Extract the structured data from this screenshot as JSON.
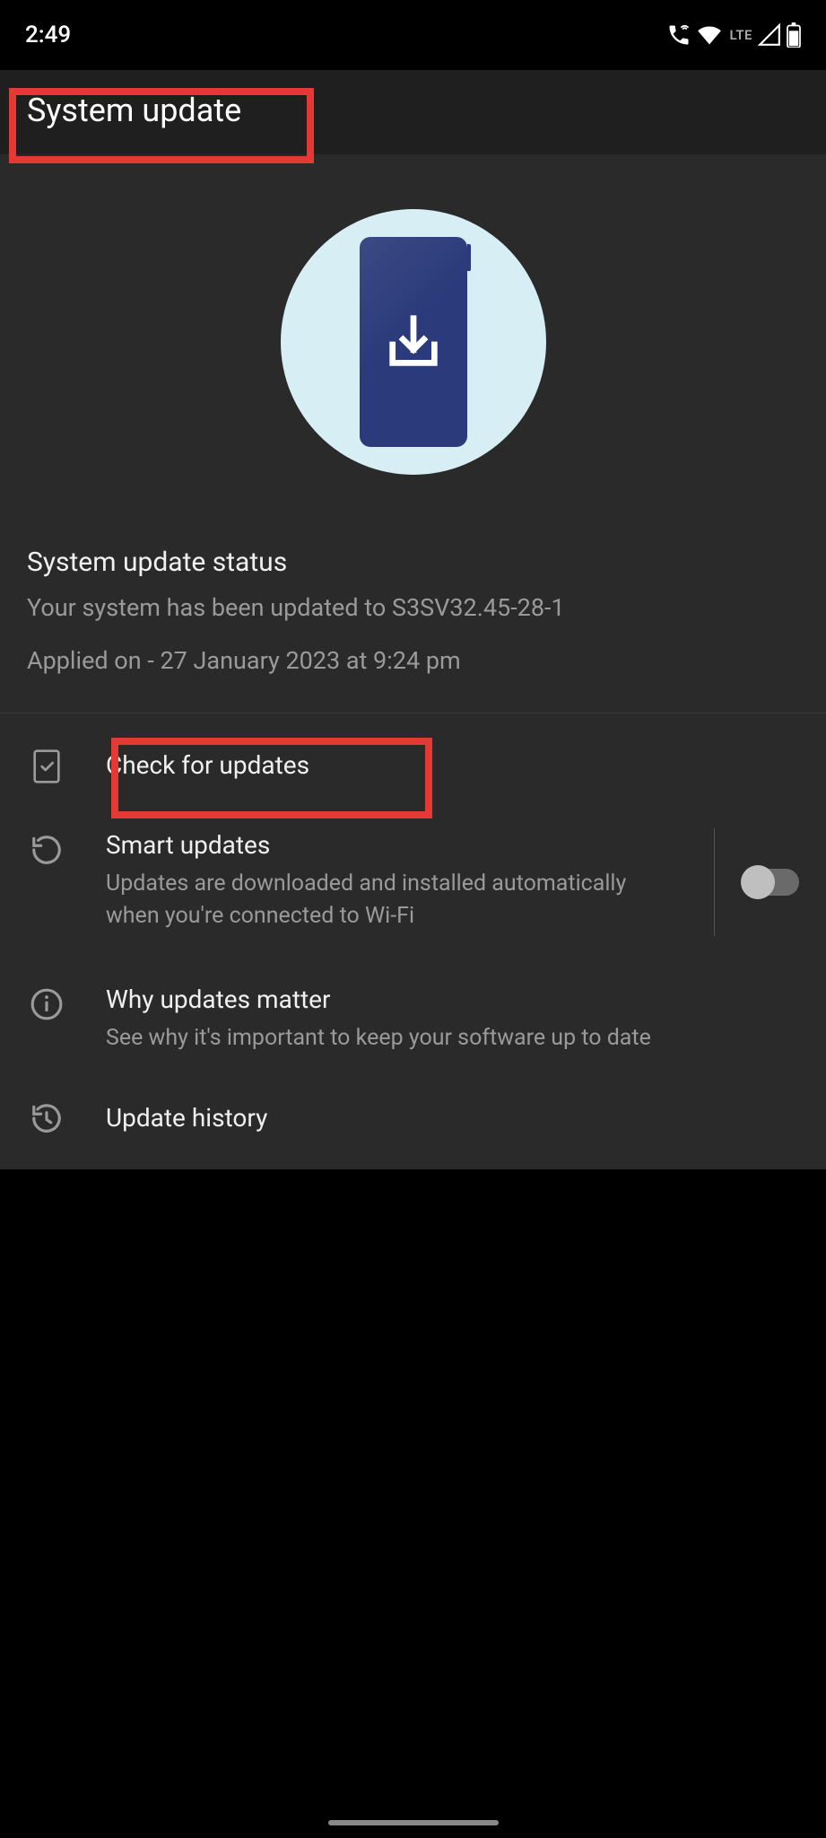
{
  "statusbar": {
    "time": "2:49",
    "network_label": "LTE"
  },
  "header": {
    "title": "System update"
  },
  "status": {
    "heading": "System update status",
    "version_line": "Your system has been updated to S3SV32.45-28-1",
    "applied_line": "Applied on - 27 January 2023 at 9:24 pm"
  },
  "menu": {
    "check": {
      "title": "Check for updates"
    },
    "smart": {
      "title": "Smart updates",
      "sub": "Updates are downloaded and installed automatically when you're connected to Wi-Fi",
      "enabled": false
    },
    "why": {
      "title": "Why updates matter",
      "sub": "See why it's important to keep your software up to date"
    },
    "history": {
      "title": "Update history"
    }
  }
}
